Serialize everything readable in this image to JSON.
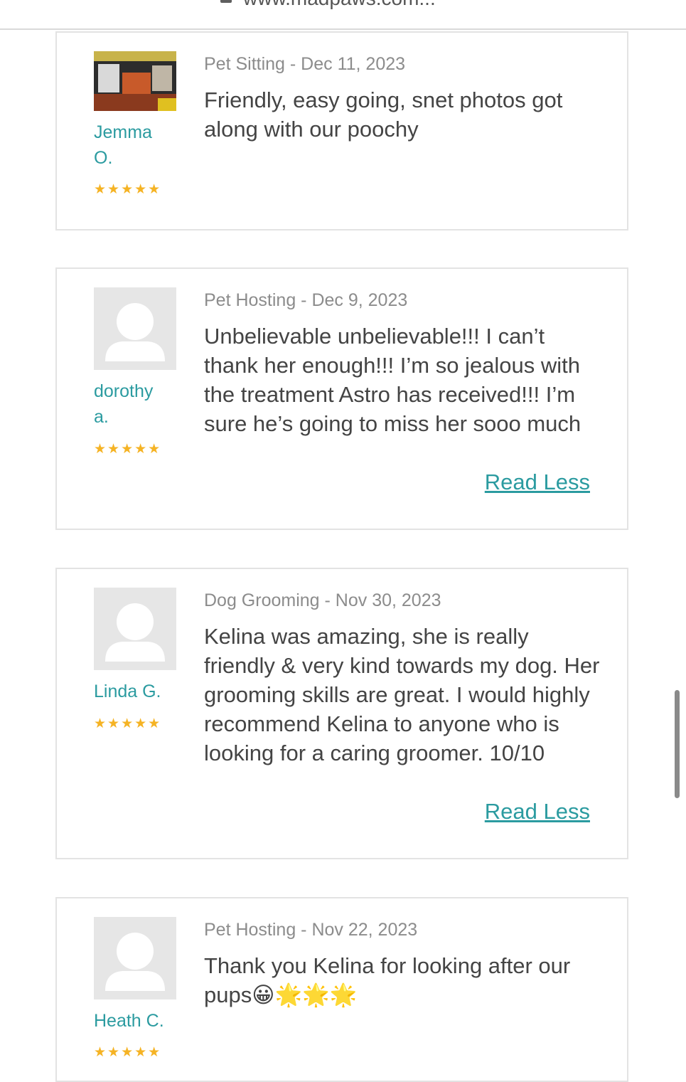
{
  "browser": {
    "url": "www.madpaws.com..."
  },
  "reviews": [
    {
      "name": "Jemma O.",
      "service": "Pet Sitting",
      "date": "Dec 11, 2023",
      "meta": "Pet Sitting - Dec 11, 2023",
      "rating": 5,
      "stars": "★★★★★",
      "text": "Friendly, easy going, snet photos got along with our poochy",
      "avatar": "photo"
    },
    {
      "name": "dorothy a.",
      "service": "Pet Hosting",
      "date": "Dec 9, 2023",
      "meta": "Pet Hosting - Dec 9, 2023",
      "rating": 5,
      "stars": "★★★★★",
      "text": "Unbelievable unbelievable!!! I can’t thank her enough!!! I’m so jealous with the treatment Astro has received!!! I’m sure he’s going to miss her sooo much",
      "read_less": "Read Less",
      "avatar": "placeholder"
    },
    {
      "name": "Linda G.",
      "service": "Dog Grooming",
      "date": "Nov 30, 2023",
      "meta": "Dog Grooming - Nov 30, 2023",
      "rating": 5,
      "stars": "★★★★★",
      "text": "Kelina was amazing, she is really friendly & very kind towards my dog. Her grooming skills are great. I would highly recommend Kelina to anyone who is looking for a caring groomer. 10/10",
      "read_less": "Read Less",
      "avatar": "placeholder"
    },
    {
      "name": "Heath C.",
      "service": "Pet Hosting",
      "date": "Nov 22, 2023",
      "meta": "Pet Hosting - Nov 22, 2023",
      "rating": 5,
      "stars": "★★★★★",
      "text": "Thank you Kelina for looking after our pups😀🌟🌟🌟",
      "avatar": "placeholder"
    }
  ],
  "colors": {
    "accent": "#2b9ba0",
    "star": "#f5b324",
    "meta": "#8c8c8c",
    "body_text": "#444444"
  }
}
